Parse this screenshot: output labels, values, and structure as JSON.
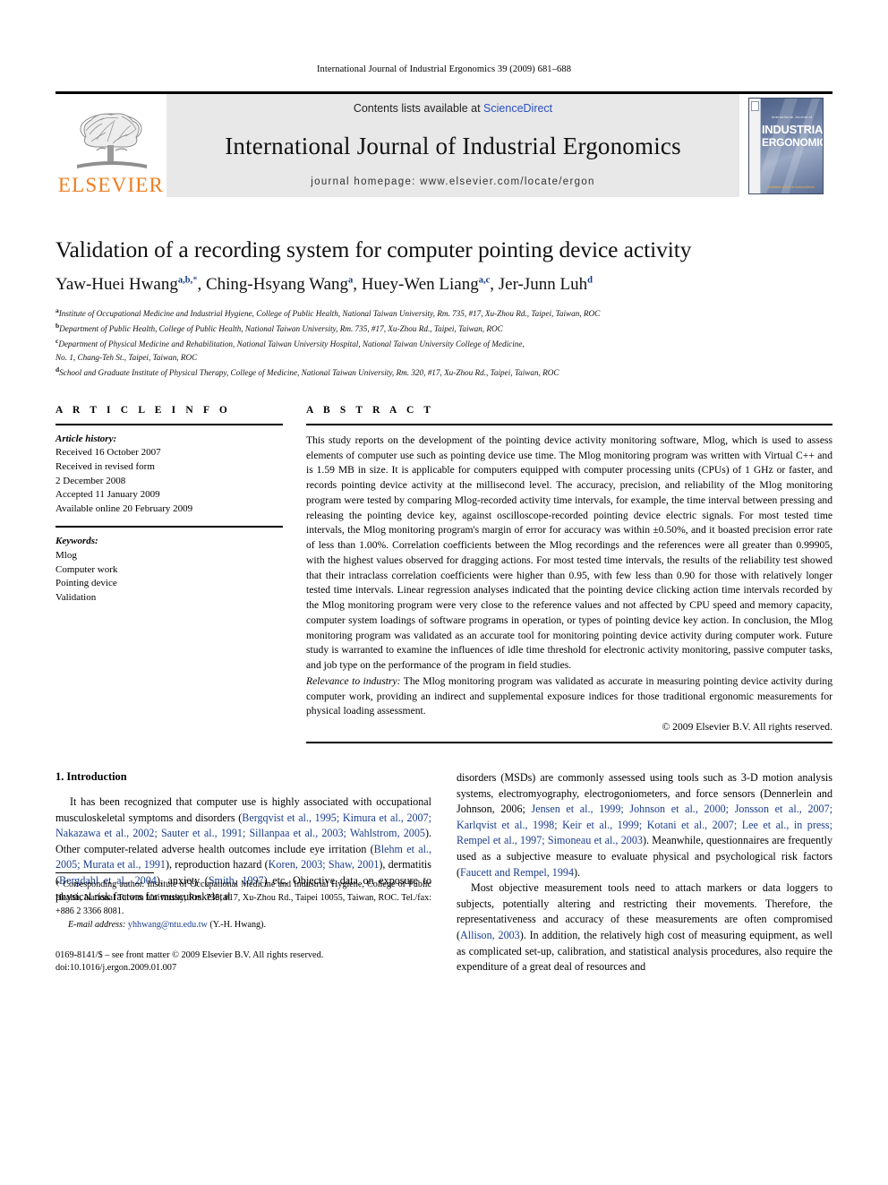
{
  "running_head": "International Journal of Industrial Ergonomics 39 (2009) 681–688",
  "masthead": {
    "publisher_logo_text": "ELSEVIER",
    "contents_prefix": "Contents lists available at ",
    "contents_link": "ScienceDirect",
    "journal_title": "International Journal of Industrial Ergonomics",
    "homepage_line": "journal homepage: www.elsevier.com/locate/ergon",
    "cover": {
      "supertitle": "International Journal of",
      "line1": "INDUSTRIAL",
      "line2": "ERGONOMICS",
      "footer": "Available online at ScienceDirect"
    }
  },
  "article": {
    "title": "Validation of a recording system for computer pointing device activity",
    "authors": [
      {
        "name": "Yaw-Huei Hwang",
        "sup": "a,b,",
        "star": "*",
        "sep": ", "
      },
      {
        "name": "Ching-Hsyang Wang",
        "sup": "a",
        "star": "",
        "sep": ", "
      },
      {
        "name": "Huey-Wen Liang",
        "sup": "a,c",
        "star": "",
        "sep": ", "
      },
      {
        "name": "Jer-Junn Luh",
        "sup": "d",
        "star": "",
        "sep": ""
      }
    ],
    "affiliations": [
      {
        "mark": "a",
        "text": "Institute of Occupational Medicine and Industrial Hygiene, College of Public Health, National Taiwan University, Rm. 735, #17, Xu-Zhou Rd., Taipei, Taiwan, ROC"
      },
      {
        "mark": "b",
        "text": "Department of Public Health, College of Public Health, National Taiwan University, Rm. 735, #17, Xu-Zhou Rd., Taipei, Taiwan, ROC"
      },
      {
        "mark": "c",
        "text": "Department of Physical Medicine and Rehabilitation, National Taiwan University Hospital, National Taiwan University College of Medicine,"
      },
      {
        "mark": "",
        "text": "No. 1, Chang-Teh St., Taipei, Taiwan, ROC"
      },
      {
        "mark": "d",
        "text": "School and Graduate Institute of Physical Therapy, College of Medicine, National Taiwan University, Rm. 320, #17, Xu-Zhou Rd., Taipei, Taiwan, ROC"
      }
    ]
  },
  "article_info": {
    "heading": "A R T I C L E   I N F O",
    "history_label": "Article history:",
    "history": [
      "Received 16 October 2007",
      "Received in revised form",
      "2 December 2008",
      "Accepted 11 January 2009",
      "Available online 20 February 2009"
    ],
    "keywords_label": "Keywords:",
    "keywords": [
      "Mlog",
      "Computer work",
      "Pointing device",
      "Validation"
    ]
  },
  "abstract": {
    "heading": "A B S T R A C T",
    "text": "This study reports on the development of the pointing device activity monitoring software, Mlog, which is used to assess elements of computer use such as pointing device use time. The Mlog monitoring program was written with Virtual C++ and is 1.59 MB in size. It is applicable for computers equipped with computer processing units (CPUs) of 1 GHz or faster, and records pointing device activity at the millisecond level. The accuracy, precision, and reliability of the Mlog monitoring program were tested by comparing Mlog-recorded activity time intervals, for example, the time interval between pressing and releasing the pointing device key, against oscilloscope-recorded pointing device electric signals. For most tested time intervals, the Mlog monitoring program's margin of error for accuracy was within ±0.50%, and it boasted precision error rate of less than 1.00%. Correlation coefficients between the Mlog recordings and the references were all greater than 0.99905, with the highest values observed for dragging actions. For most tested time intervals, the results of the reliability test showed that their intraclass correlation coefficients were higher than 0.95, with few less than 0.90 for those with relatively longer tested time intervals. Linear regression analyses indicated that the pointing device clicking action time intervals recorded by the Mlog monitoring program were very close to the reference values and not affected by CPU speed and memory capacity, computer system loadings of software programs in operation, or types of pointing device key action. In conclusion, the Mlog monitoring program was validated as an accurate tool for monitoring pointing device activity during computer work. Future study is warranted to examine the influences of idle time threshold for electronic activity monitoring, passive computer tasks, and job type on the performance of the program in field studies.",
    "relevance_label": "Relevance to industry:",
    "relevance_text": " The Mlog monitoring program was validated as accurate in measuring pointing device activity during computer work, providing an indirect and supplemental exposure indices for those traditional ergonomic measurements for physical loading assessment.",
    "copyright": "© 2009 Elsevier B.V. All rights reserved."
  },
  "introduction": {
    "heading": "1.  Introduction",
    "paragraph_1_parts": [
      {
        "t": "It has been recognized that computer use is highly associated with occupational musculoskeletal symptoms and disorders (",
        "cite": false
      },
      {
        "t": "Bergqvist et al., 1995; Kimura et al., 2007; Nakazawa et al., 2002; Sauter et al., 1991; Sillanpaa et al., 2003; Wahlstrom, 2005",
        "cite": true
      },
      {
        "t": "). Other computer-related adverse health outcomes include eye irritation (",
        "cite": false
      },
      {
        "t": "Blehm et al., 2005; Murata et al., 1991",
        "cite": true
      },
      {
        "t": "), reproduction hazard (",
        "cite": false
      },
      {
        "t": "Koren, 2003; Shaw, 2001",
        "cite": true
      },
      {
        "t": "), dermatitis (",
        "cite": false
      },
      {
        "t": "Bergdahl et al., 2004",
        "cite": true
      },
      {
        "t": "), anxiety (",
        "cite": false
      },
      {
        "t": "Smith, 1997",
        "cite": true
      },
      {
        "t": ") etc. Objective data on exposure to physical risk factors for musculoskeletal disorders (MSDs) are commonly assessed using tools such as 3-D motion analysis systems, electromyography, electrogoniometers, and force sensors (Dennerlein and Johnson, 2006; ",
        "cite": false
      },
      {
        "t": "Jensen et al., 1999; Johnson et al., 2000; Jonsson et al., 2007; Karlqvist et al., 1998; Keir et al., 1999; Kotani et al., 2007; Lee et al., in press; Rempel et al., 1997; Simoneau et al., 2003",
        "cite": true
      },
      {
        "t": "). Meanwhile, questionnaires are frequently used as a subjective measure to evaluate physical and psychological risk factors (",
        "cite": false
      },
      {
        "t": "Faucett and Rempel, 1994",
        "cite": true
      },
      {
        "t": ").",
        "cite": false
      }
    ],
    "paragraph_2_parts": [
      {
        "t": "Most objective measurement tools need to attach markers or data loggers to subjects, potentially altering and restricting their movements. Therefore, the representativeness and accuracy of these measurements are often compromised (",
        "cite": false
      },
      {
        "t": "Allison, 2003",
        "cite": true
      },
      {
        "t": "). In addition, the relatively high cost of measuring equipment, as well as complicated set-up, calibration, and statistical analysis procedures, also require the expenditure of a great deal of resources and",
        "cite": false
      }
    ]
  },
  "footnote": {
    "corresponding": "* Corresponding author. Institute of Occupational Medicine and Industrial Hygiene, College of Public Health, National Taiwan University, Rm. 735, #17, Xu-Zhou Rd., Taipei 10055, Taiwan, ROC. Tel./fax: +886 2 3366 8081.",
    "email_label": "E-mail address:",
    "email": "yhhwang@ntu.edu.tw",
    "email_suffix": " (Y.-H. Hwang).",
    "imprint_line1": "0169-8141/$ – see front matter © 2009 Elsevier B.V. All rights reserved.",
    "imprint_line2": "doi:10.1016/j.ergon.2009.01.007"
  },
  "colors": {
    "elsevier_orange": "#F07C1E",
    "link_blue": "#2a4fc4",
    "citation_blue": "#1a3e8c",
    "masthead_gray": "#e8e8e8"
  }
}
